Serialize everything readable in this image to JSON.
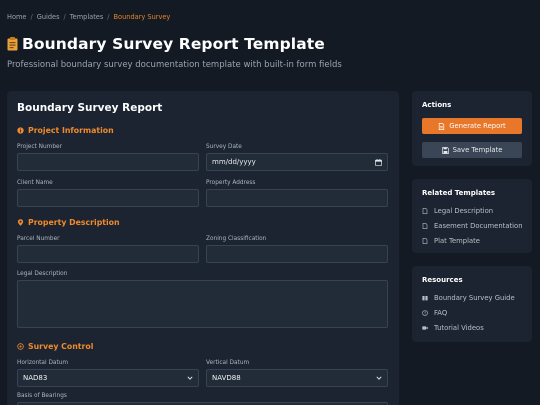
{
  "breadcrumb": {
    "items": [
      "Home",
      "Guides",
      "Templates"
    ],
    "current": "Boundary Survey",
    "separator": "/"
  },
  "header": {
    "title": "Boundary Survey Report Template",
    "subtitle": "Professional boundary survey documentation template with built-in form fields",
    "icon": "clipboard-icon"
  },
  "form": {
    "title": "Boundary Survey Report",
    "sections": {
      "project": {
        "heading": "Project Information",
        "icon": "info-circle-icon",
        "project_number_label": "Project Number",
        "survey_date_label": "Survey Date",
        "survey_date_placeholder": "mm/dd/yyyy",
        "client_name_label": "Client Name",
        "property_address_label": "Property Address"
      },
      "property": {
        "heading": "Property Description",
        "icon": "map-pin-icon",
        "parcel_number_label": "Parcel Number",
        "zoning_label": "Zoning Classification",
        "legal_description_label": "Legal Description"
      },
      "control": {
        "heading": "Survey Control",
        "icon": "crosshair-icon",
        "horizontal_datum_label": "Horizontal Datum",
        "horizontal_datum_value": "NAD83",
        "vertical_datum_label": "Vertical Datum",
        "vertical_datum_value": "NAVD88",
        "basis_of_bearings_label": "Basis of Bearings"
      }
    }
  },
  "sidebar": {
    "actions": {
      "title": "Actions",
      "generate_label": "Generate Report",
      "save_label": "Save Template"
    },
    "related": {
      "title": "Related Templates",
      "items": [
        "Legal Description",
        "Easement Documentation",
        "Plat Template"
      ]
    },
    "resources": {
      "title": "Resources",
      "items": [
        "Boundary Survey Guide",
        "FAQ",
        "Tutorial Videos"
      ]
    }
  },
  "colors": {
    "background": "#131a24",
    "card": "#1b2430",
    "accent": "#e8772a",
    "input": "#222c39"
  }
}
